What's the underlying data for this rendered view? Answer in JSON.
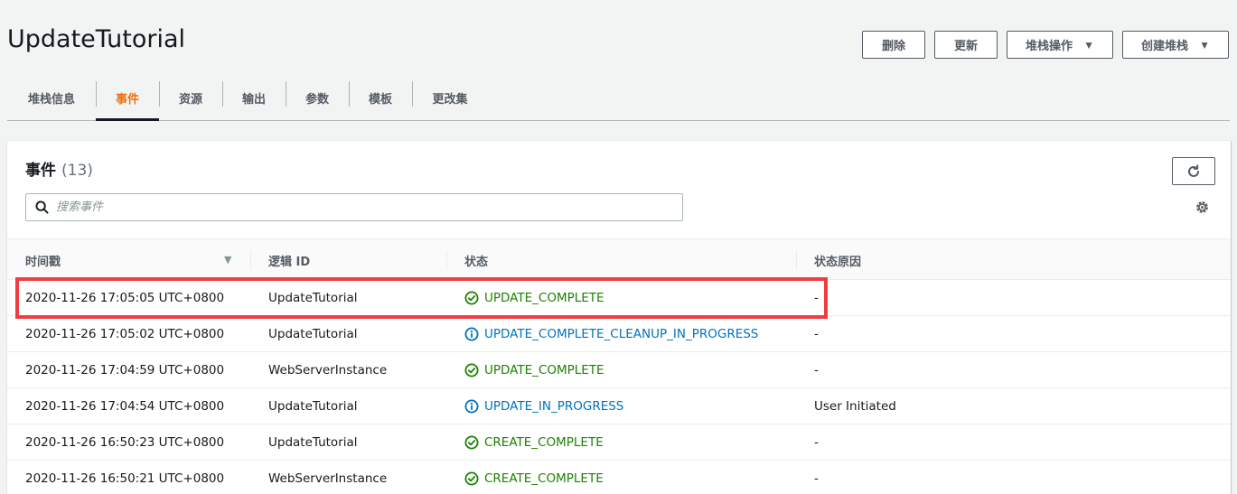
{
  "page": {
    "title": "UpdateTutorial"
  },
  "actions": {
    "delete_label": "删除",
    "update_label": "更新",
    "stack_actions_label": "堆栈操作",
    "create_stack_label": "创建堆栈"
  },
  "tabs": [
    {
      "label": "堆栈信息",
      "active": false
    },
    {
      "label": "事件",
      "active": true
    },
    {
      "label": "资源",
      "active": false
    },
    {
      "label": "输出",
      "active": false
    },
    {
      "label": "参数",
      "active": false
    },
    {
      "label": "模板",
      "active": false
    },
    {
      "label": "更改集",
      "active": false
    }
  ],
  "events_panel": {
    "title": "事件",
    "count": "(13)",
    "search_placeholder": "搜索事件",
    "columns": {
      "timestamp": "时间戳",
      "logical_id": "逻辑 ID",
      "status": "状态",
      "status_reason": "状态原因"
    },
    "rows": [
      {
        "timestamp": "2020-11-26 17:05:05 UTC+0800",
        "logical_id": "UpdateTutorial",
        "status": "UPDATE_COMPLETE",
        "status_type": "success",
        "reason": "-"
      },
      {
        "timestamp": "2020-11-26 17:05:02 UTC+0800",
        "logical_id": "UpdateTutorial",
        "status": "UPDATE_COMPLETE_CLEANUP_IN_PROGRESS",
        "status_type": "info",
        "reason": "-"
      },
      {
        "timestamp": "2020-11-26 17:04:59 UTC+0800",
        "logical_id": "WebServerInstance",
        "status": "UPDATE_COMPLETE",
        "status_type": "success",
        "reason": "-"
      },
      {
        "timestamp": "2020-11-26 17:04:54 UTC+0800",
        "logical_id": "UpdateTutorial",
        "status": "UPDATE_IN_PROGRESS",
        "status_type": "info",
        "reason": "User Initiated"
      },
      {
        "timestamp": "2020-11-26 16:50:23 UTC+0800",
        "logical_id": "UpdateTutorial",
        "status": "CREATE_COMPLETE",
        "status_type": "success",
        "reason": "-"
      },
      {
        "timestamp": "2020-11-26 16:50:21 UTC+0800",
        "logical_id": "WebServerInstance",
        "status": "CREATE_COMPLETE",
        "status_type": "success",
        "reason": "-"
      }
    ]
  },
  "icons": {
    "success": "check-circle-icon",
    "info": "info-circle-icon",
    "refresh": "refresh-icon",
    "settings": "gear-icon",
    "search": "search-icon",
    "sort": "caret-down-icon"
  },
  "colors": {
    "accent_tab": "#ec7211",
    "success": "#1d8102",
    "info": "#0073bb",
    "highlight": "#ef3e42"
  }
}
